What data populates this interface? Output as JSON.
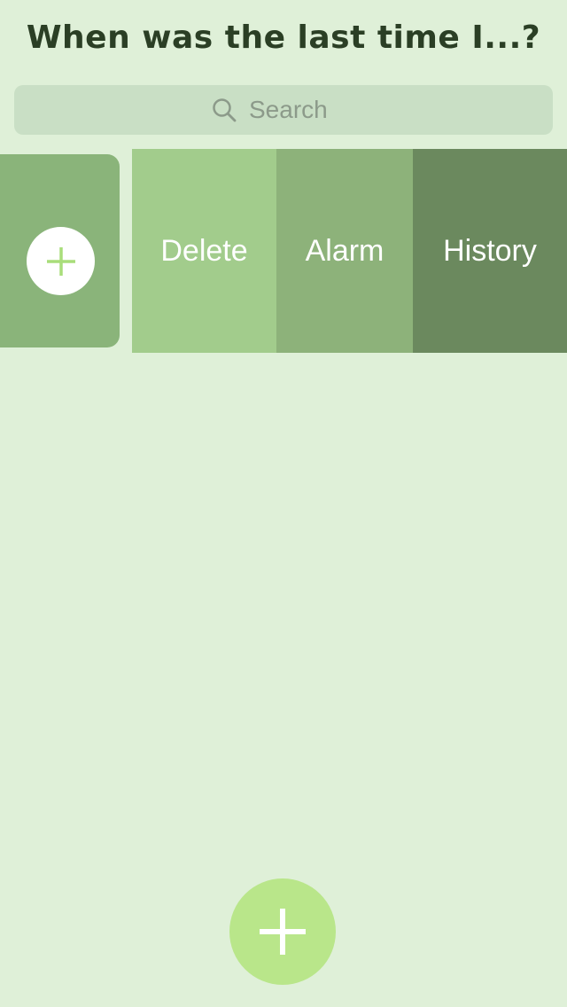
{
  "header": {
    "title": "When was the last time I...?"
  },
  "search": {
    "placeholder": "Search",
    "icon": "search-icon"
  },
  "list_row": {
    "add_button_icon": "plus-icon",
    "actions": [
      {
        "label": "Delete",
        "color": "#a2cc8c"
      },
      {
        "label": "Alarm",
        "color": "#8db27a"
      },
      {
        "label": "History",
        "color": "#6b895e"
      }
    ]
  },
  "fab": {
    "icon": "plus-icon",
    "color": "#b9e68a"
  },
  "colors": {
    "background": "#dff0d8",
    "title": "#2b3f25",
    "row_card": "#8ab47a",
    "plus_accent": "#a9dd7a"
  }
}
